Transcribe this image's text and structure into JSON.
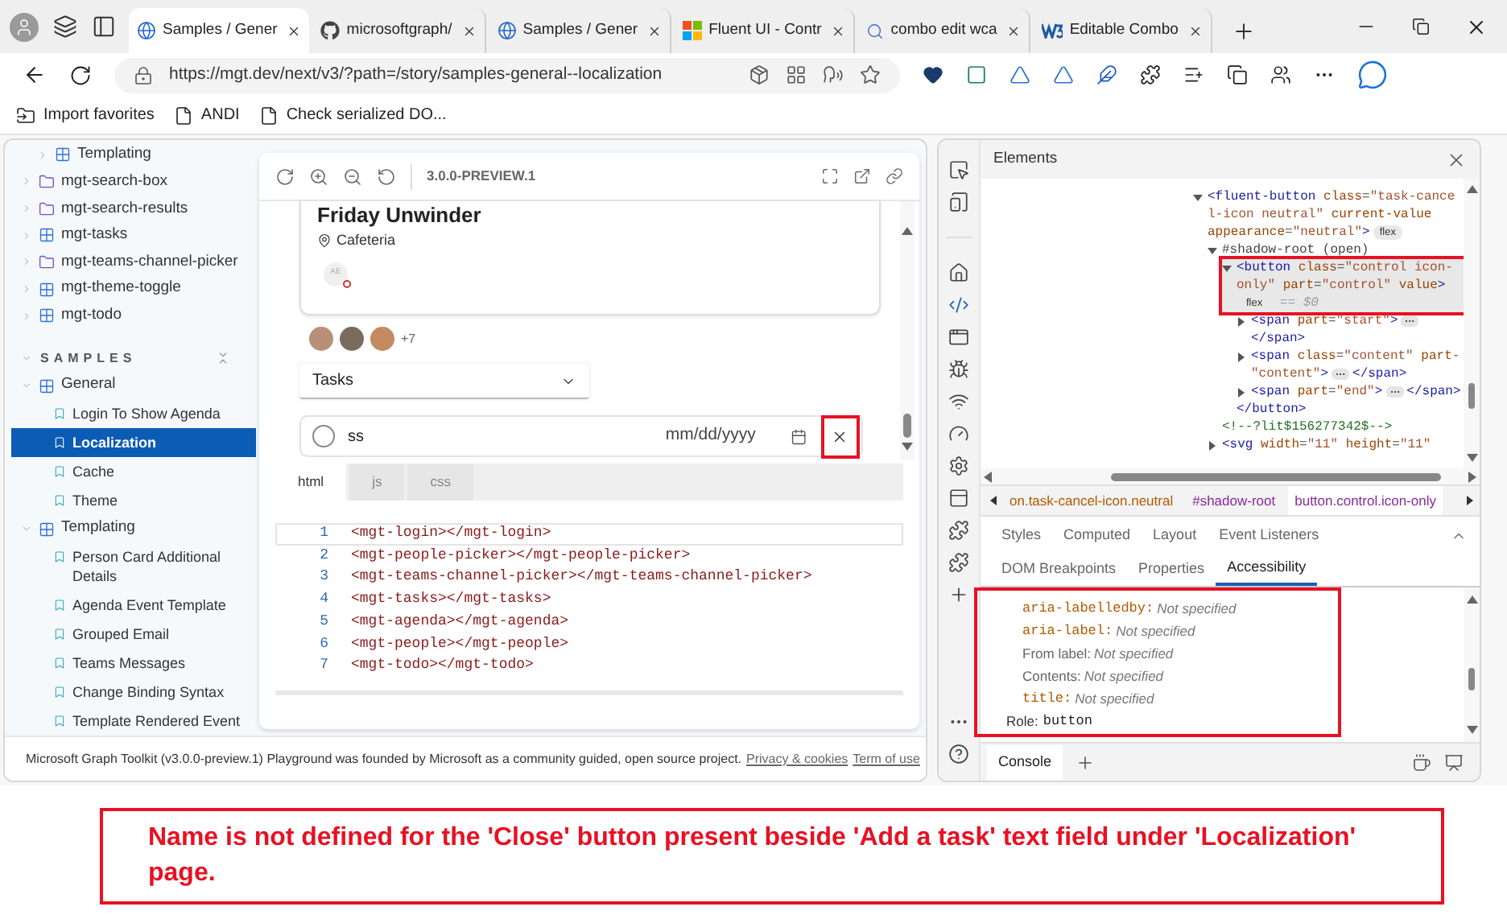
{
  "browser": {
    "tabs": [
      {
        "title": "Samples / Gener",
        "kind": "globe",
        "selected": true
      },
      {
        "title": "microsoftgraph/",
        "kind": "github",
        "selected": false
      },
      {
        "title": "Samples / Gener",
        "kind": "globe",
        "selected": false
      },
      {
        "title": "Fluent UI - Contr",
        "kind": "windows",
        "selected": false
      },
      {
        "title": "combo edit wca",
        "kind": "search",
        "selected": false
      },
      {
        "title": "Editable Combo",
        "kind": "w3",
        "selected": false
      }
    ],
    "address": "https://mgt.dev/next/v3/?path=/story/samples-general--localization",
    "favorites": [
      {
        "label": "Import favorites",
        "kind": "import"
      },
      {
        "label": "ANDI",
        "kind": "page"
      },
      {
        "label": "Check serialized DO...",
        "kind": "page"
      }
    ]
  },
  "sidebar": {
    "nested_item": {
      "label": "Templating",
      "kind": "component",
      "expanded": false
    },
    "components": [
      {
        "label": "mgt-search-box",
        "kind": "folder",
        "expanded": false
      },
      {
        "label": "mgt-search-results",
        "kind": "folder",
        "expanded": false
      },
      {
        "label": "mgt-tasks",
        "kind": "component",
        "expanded": false
      },
      {
        "label": "mgt-teams-channel-picker",
        "kind": "folder",
        "expanded": false
      },
      {
        "label": "mgt-theme-toggle",
        "kind": "component",
        "expanded": false
      },
      {
        "label": "mgt-todo",
        "kind": "component",
        "expanded": false
      }
    ],
    "section": {
      "label": "SAMPLES",
      "expanded": true
    },
    "groups": [
      {
        "label": "General",
        "expanded": true,
        "children": [
          {
            "label": "Login To Show Agenda",
            "selected": false
          },
          {
            "label": "Localization",
            "selected": true
          },
          {
            "label": "Cache",
            "selected": false
          },
          {
            "label": "Theme",
            "selected": false
          }
        ]
      },
      {
        "label": "Templating",
        "expanded": true,
        "children": [
          {
            "label": "Person Card Additional Details",
            "selected": false
          },
          {
            "label": "Agenda Event Template",
            "selected": false
          },
          {
            "label": "Grouped Email",
            "selected": false
          },
          {
            "label": "Teams Messages",
            "selected": false
          },
          {
            "label": "Change Binding Syntax",
            "selected": false
          },
          {
            "label": "Template Rendered Event",
            "selected": false
          }
        ]
      }
    ]
  },
  "preview": {
    "version": "3.0.0-PREVIEW.1",
    "event": {
      "title": "Friday Unwinder",
      "location": "Cafeteria",
      "attendee_initials": "AE"
    },
    "people_more": "+7",
    "list_dropdown": {
      "value": "Tasks"
    },
    "new_task": {
      "value": "ss",
      "date_placeholder": "mm/dd/yyyy",
      "close_highlighted": true
    },
    "code_tabs": [
      {
        "label": "html",
        "selected": true
      },
      {
        "label": "js",
        "selected": false
      },
      {
        "label": "css",
        "selected": false
      }
    ],
    "code_lines": [
      {
        "number": "1",
        "code": "<mgt-login></mgt-login>"
      },
      {
        "number": "2",
        "code": "<mgt-people-picker></mgt-people-picker>"
      },
      {
        "number": "3",
        "code": "<mgt-teams-channel-picker></mgt-teams-channel-picker>"
      },
      {
        "number": "4",
        "code": "<mgt-tasks></mgt-tasks>"
      },
      {
        "number": "5",
        "code": "<mgt-agenda></mgt-agenda>"
      },
      {
        "number": "6",
        "code": "<mgt-people></mgt-people>"
      },
      {
        "number": "7",
        "code": "<mgt-todo></mgt-todo>"
      }
    ]
  },
  "footer": {
    "text": "Microsoft Graph Toolkit (v3.0.0-preview.1) Playground was founded by Microsoft as a community guided, open source project.",
    "links": [
      "Privacy & cookies",
      "Term of use"
    ]
  },
  "devtools": {
    "title": "Elements",
    "dom": [
      {
        "expanded": true,
        "lines": [
          [
            {
              "kind": "tag",
              "text": "<fluent-button"
            },
            {
              "kind": "attr",
              "text": " class"
            },
            {
              "kind": "plain",
              "text": "="
            },
            {
              "kind": "val",
              "text": "\"task-cance"
            }
          ],
          [
            {
              "kind": "val",
              "text": "l-icon neutral\""
            },
            {
              "kind": "attr",
              "text": " current-value"
            }
          ],
          [
            {
              "kind": "attr",
              "text": "appearance"
            },
            {
              "kind": "plain",
              "text": "="
            },
            {
              "kind": "val",
              "text": "\"neutral\""
            },
            {
              "kind": "tag",
              "text": ">"
            },
            {
              "kind": "badge",
              "text": "flex"
            }
          ]
        ],
        "children": [
          {
            "expanded": true,
            "lines": [
              [
                {
                  "kind": "plain",
                  "text": "#shadow-root (open)"
                }
              ]
            ],
            "children": [
              {
                "expanded": true,
                "selected": true,
                "highlighted": true,
                "lines": [
                  [
                    {
                      "kind": "tag",
                      "text": "<button"
                    },
                    {
                      "kind": "attr",
                      "text": " class"
                    },
                    {
                      "kind": "plain",
                      "text": "="
                    },
                    {
                      "kind": "val",
                      "text": "\"control icon-"
                    }
                  ],
                  [
                    {
                      "kind": "val",
                      "text": "only\""
                    },
                    {
                      "kind": "attr",
                      "text": " part"
                    },
                    {
                      "kind": "plain",
                      "text": "="
                    },
                    {
                      "kind": "val",
                      "text": "\"control\""
                    },
                    {
                      "kind": "attr",
                      "text": " value"
                    },
                    {
                      "kind": "tag",
                      "text": ">"
                    }
                  ],
                  [
                    {
                      "kind": "badge",
                      "text": "flex"
                    },
                    {
                      "kind": "note",
                      "text": " == $0"
                    }
                  ]
                ],
                "children": [
                  {
                    "expanded": false,
                    "lines": [
                      [
                        {
                          "kind": "tag",
                          "text": "<span"
                        },
                        {
                          "kind": "attr",
                          "text": " part"
                        },
                        {
                          "kind": "plain",
                          "text": "="
                        },
                        {
                          "kind": "val",
                          "text": "\"start\""
                        },
                        {
                          "kind": "tag",
                          "text": ">"
                        },
                        {
                          "kind": "dots"
                        }
                      ],
                      [
                        {
                          "kind": "tag",
                          "text": "</span>"
                        }
                      ]
                    ]
                  },
                  {
                    "expanded": false,
                    "lines": [
                      [
                        {
                          "kind": "tag",
                          "text": "<span"
                        },
                        {
                          "kind": "attr",
                          "text": " class"
                        },
                        {
                          "kind": "plain",
                          "text": "="
                        },
                        {
                          "kind": "val",
                          "text": "\"content\""
                        },
                        {
                          "kind": "attr",
                          "text": " part-"
                        }
                      ],
                      [
                        {
                          "kind": "val",
                          "text": "\"content\""
                        },
                        {
                          "kind": "tag",
                          "text": ">"
                        },
                        {
                          "kind": "dots"
                        },
                        {
                          "kind": "tag",
                          "text": "</span>"
                        }
                      ]
                    ]
                  },
                  {
                    "expanded": false,
                    "lines": [
                      [
                        {
                          "kind": "tag",
                          "text": "<span"
                        },
                        {
                          "kind": "attr",
                          "text": " part"
                        },
                        {
                          "kind": "plain",
                          "text": "="
                        },
                        {
                          "kind": "val",
                          "text": "\"end\""
                        },
                        {
                          "kind": "tag",
                          "text": ">"
                        },
                        {
                          "kind": "dots"
                        },
                        {
                          "kind": "tag",
                          "text": "</span>"
                        }
                      ]
                    ]
                  }
                ],
                "close": "</button>"
              }
            ]
          },
          {
            "lines": [
              [
                {
                  "kind": "comment",
                  "text": "<!--?lit$156277342$-->"
                }
              ]
            ]
          },
          {
            "expanded": false,
            "lines": [
              [
                {
                  "kind": "tag",
                  "text": "<svg"
                },
                {
                  "kind": "attr",
                  "text": " width"
                },
                {
                  "kind": "plain",
                  "text": "="
                },
                {
                  "kind": "val",
                  "text": "\"11\""
                },
                {
                  "kind": "attr",
                  "text": " height"
                },
                {
                  "kind": "plain",
                  "text": "="
                },
                {
                  "kind": "val",
                  "text": "\"11\""
                }
              ]
            ]
          }
        ]
      }
    ],
    "breadcrumbs": [
      {
        "label": "on.task-cancel-icon.neutral",
        "selected": false
      },
      {
        "label": "#shadow-root",
        "selected": false
      },
      {
        "label": "button.control.icon-only",
        "selected": true
      }
    ],
    "panel_tabs": [
      [
        {
          "label": "Styles",
          "selected": false
        },
        {
          "label": "Computed",
          "selected": false
        },
        {
          "label": "Layout",
          "selected": false
        },
        {
          "label": "Event Listeners",
          "selected": false
        }
      ],
      [
        {
          "label": "DOM Breakpoints",
          "selected": false
        },
        {
          "label": "Properties",
          "selected": false
        },
        {
          "label": "Accessibility",
          "selected": true
        }
      ]
    ],
    "accessibility": {
      "highlighted": true,
      "rows": [
        {
          "name": "aria-labelledby:",
          "kind": "attribute",
          "value": "Not specified"
        },
        {
          "name": "aria-label:",
          "kind": "attribute",
          "value": "Not specified"
        },
        {
          "name": "From label:",
          "kind": "source",
          "value": "Not specified"
        },
        {
          "name": "Contents:",
          "kind": "source",
          "value": "Not specified"
        },
        {
          "name": "title:",
          "kind": "attribute",
          "value": "Not specified"
        }
      ],
      "role": {
        "label": "Role:",
        "value": "button"
      }
    },
    "drawer_tabs": [
      {
        "label": "Console",
        "selected": true
      }
    ]
  },
  "annotation": "Name is not defined for the 'Close' button present beside 'Add a task' text field under 'Localization' page."
}
